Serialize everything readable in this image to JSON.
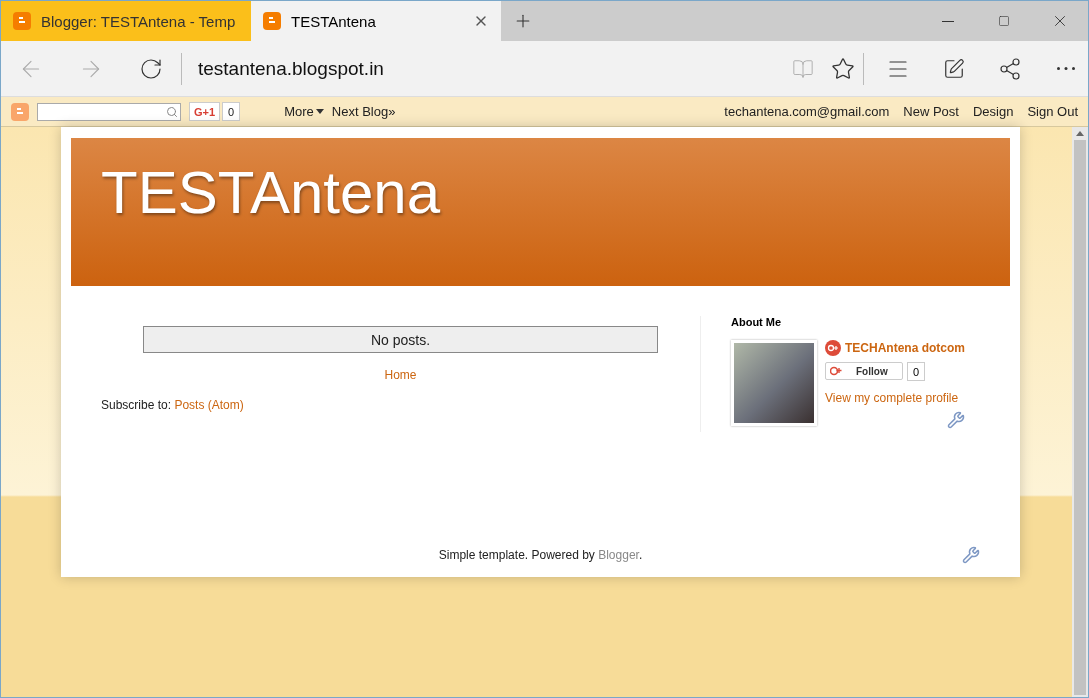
{
  "tabs": [
    {
      "title": "Blogger: TESTAntena - Temp",
      "selected": false
    },
    {
      "title": "TESTAntena",
      "selected": true
    }
  ],
  "address": "testantena.blogspot.in",
  "navbar": {
    "gplus_label": "G+1",
    "gplus_count": "0",
    "more": "More",
    "next_blog": "Next Blog»",
    "links": [
      "techantena.com@gmail.com",
      "New Post",
      "Design",
      "Sign Out"
    ]
  },
  "blog": {
    "title": "TESTAntena",
    "posts_message": "No posts.",
    "home_link": "Home",
    "subscribe_label": "Subscribe to:",
    "subscribe_link": "Posts (Atom)"
  },
  "sidebar": {
    "heading": "About Me",
    "profile_name": "TECHAntena dotcom",
    "follow_label": "Follow",
    "follow_count": "0",
    "profile_link": "View my complete profile"
  },
  "footer": {
    "text": "Simple template. Powered by ",
    "link": "Blogger",
    "after": "."
  }
}
